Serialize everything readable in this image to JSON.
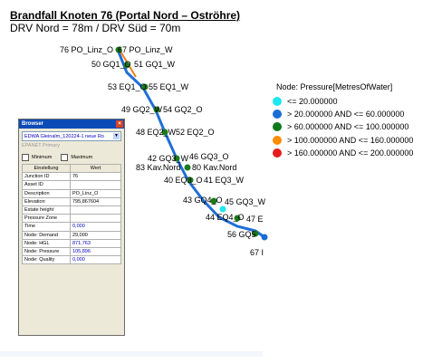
{
  "header": {
    "title": "Brandfall Knoten 76 (Portal Nord – Oströhre)",
    "subtitle": "DRV Nord = 78m / DRV Süd = 70m"
  },
  "map": {
    "node_labels": [
      "76 PO_Linz_O",
      "67 PO_Linz_W",
      "50 GQ1_O",
      "51 GQ1_W",
      "53 EQ1_O",
      "55 EQ1_W",
      "49 GQ2_W",
      "54 GQ2_O",
      "48 EQ2_W",
      "52 EQ2_O",
      "42 GQ3_W",
      "46 GQ3_O",
      "83 Kav.Nord",
      "80 Kav.Nord",
      "40 EQ3_O",
      "41 EQ3_W",
      "43 GQ4_O",
      "45 GQ3_W",
      "44 EQ4_O",
      "47 E",
      "56 GQ5",
      "67 I"
    ],
    "colors": {
      "pipe": "#1f6fd8",
      "node_green": "#1a7a1a"
    }
  },
  "legend": {
    "title": "Node: Pressure[MetresOfWater]",
    "items": [
      {
        "label": "<= 20.000000",
        "color": "#1ee8f0"
      },
      {
        "label": "> 20.000000 AND <= 60.000000",
        "color": "#1a6cd6"
      },
      {
        "label": "> 60.000000 AND <= 100.000000",
        "color": "#0f7a1a"
      },
      {
        "label": "> 100.000000 AND <= 160.000000",
        "color": "#ff8c00"
      },
      {
        "label": "> 160.000000 AND <= 200.000000",
        "color": "#e81b1b"
      }
    ]
  },
  "browser": {
    "title": "Browser",
    "close": "×",
    "scenario": "EDWA Gleinalm_120224-1 neue Ro",
    "subtitle": "EPANET Primary",
    "minimum": "Minimum",
    "maximum": "Maximum",
    "headers": {
      "setting": "Einstellung",
      "value": "Wert"
    },
    "rows": [
      {
        "label": "Junction ID",
        "value": "76"
      },
      {
        "label": "Asset ID",
        "value": ""
      },
      {
        "label": "Description",
        "value": "PO_Linz_O"
      },
      {
        "label": "Elevation",
        "value": "795,867604"
      },
      {
        "label": "Estate height",
        "value": ""
      },
      {
        "label": "Pressure Zone",
        "value": ""
      },
      {
        "label": "Time",
        "value": "0,000"
      },
      {
        "label": "Node: Demand",
        "value": "29,000"
      },
      {
        "label": "Node: HGL",
        "value": "871,763"
      },
      {
        "label": "Node: Pressure",
        "value": "105,896"
      },
      {
        "label": "Node: Quality",
        "value": "0,000"
      }
    ]
  }
}
